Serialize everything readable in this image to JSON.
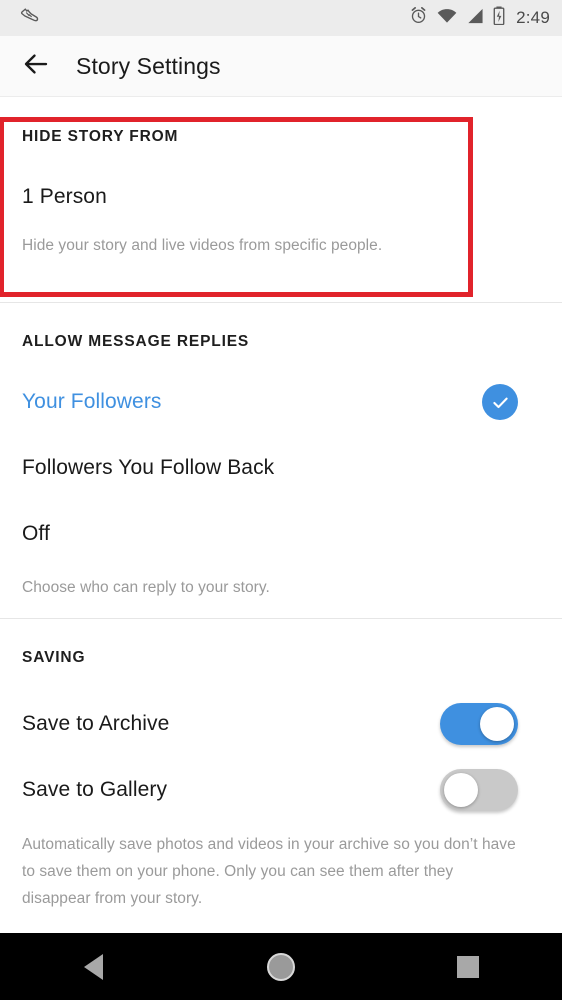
{
  "status_bar": {
    "notification_icon": "shoe-icon",
    "icons": [
      "alarm-icon",
      "wifi-icon",
      "cellular-signal-icon",
      "battery-charging-icon"
    ],
    "time": "2:49",
    "background_color": "#ececec"
  },
  "app_bar": {
    "back_icon": "arrow-left-icon",
    "title": "Story Settings"
  },
  "highlight": {
    "color": "#e1232b",
    "target_section": "HIDE STORY FROM"
  },
  "sections": [
    {
      "id": "hide-story-from",
      "header": "HIDE STORY FROM",
      "value": "1 Person",
      "description": "Hide your story and live videos from specific people."
    },
    {
      "id": "allow-message-replies",
      "header": "ALLOW MESSAGE REPLIES",
      "options": [
        {
          "label": "Your Followers",
          "selected": true
        },
        {
          "label": "Followers You Follow Back",
          "selected": false
        },
        {
          "label": "Off",
          "selected": false
        }
      ],
      "description": "Choose who can reply to your story.",
      "selected_color": "#3f90e0",
      "check_icon": "check-circle-icon"
    },
    {
      "id": "saving",
      "header": "SAVING",
      "toggles": [
        {
          "label": "Save to Archive",
          "on": true
        },
        {
          "label": "Save to Gallery",
          "on": false
        }
      ],
      "description": "Automatically save photos and videos in your archive so you don’t have to save them on your phone. Only you can see them after they disappear from your story."
    }
  ],
  "nav_bar": {
    "back": "back-triangle-icon",
    "home": "home-circle-icon",
    "recents": "recents-square-icon",
    "background_color": "#000000"
  }
}
